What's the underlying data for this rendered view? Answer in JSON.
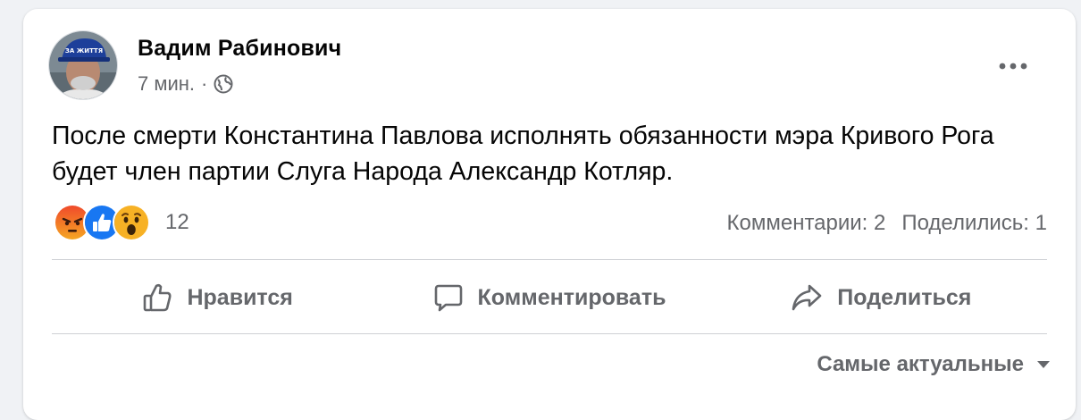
{
  "post": {
    "author": "Вадим Рабинович",
    "time": "7 мин.",
    "separator": "·",
    "text": "После смерти Константина Павлова исполнять обязанности мэра Кривого Рога будет член партии Слуга Народа Александр Котляр.",
    "avatar_cap_text": "ЗА ЖИТТЯ"
  },
  "reactions": {
    "icons": [
      "angry-reaction",
      "like-reaction",
      "wow-reaction"
    ],
    "count": "12"
  },
  "stats": {
    "comments": "Комментарии: 2",
    "shares": "Поделились: 1"
  },
  "actions": {
    "like": "Нравится",
    "comment": "Комментировать",
    "share": "Поделиться"
  },
  "sort": {
    "label": "Самые актуальные"
  },
  "colors": {
    "accent": "#1877f2",
    "secondary_text": "#65676b",
    "divider": "#ced0d4",
    "angry": "#e9710f",
    "wow": "#f7b125"
  }
}
